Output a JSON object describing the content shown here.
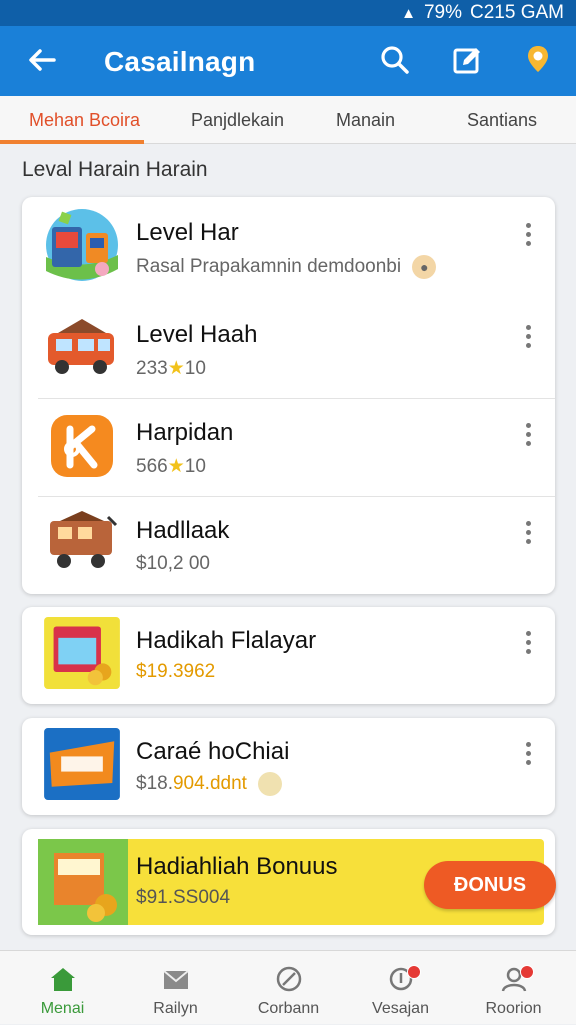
{
  "status_bar": {
    "battery": "79%",
    "time": "C215 GAM"
  },
  "app_bar": {
    "title": "Casailnagn"
  },
  "tabs": [
    {
      "label": "Mehan Bcoira",
      "active": true
    },
    {
      "label": "Panjdlekain"
    },
    {
      "label": "Manain"
    },
    {
      "label": "Santians"
    }
  ],
  "section_title": "Leval Harain Harain",
  "items": [
    {
      "name": "Level Har",
      "sub": "Rasal Prapakamnin demdoonbi"
    },
    {
      "name": "Level Haah",
      "sub": "233",
      "sub2": "10"
    },
    {
      "name": "Harpidan",
      "sub": "566",
      "sub2": "10"
    },
    {
      "name": "Hadllaak",
      "sub": "$10,2 00"
    },
    {
      "name": "Hadikah Flalayar",
      "sub": "$19.3962"
    },
    {
      "name": "Caraé hoChiai",
      "sub": "$18.",
      "sub_gold": "904.ddnt"
    },
    {
      "name": "Hadiahliah Bonuus",
      "sub": "$91.SS004",
      "button": "ĐONUS"
    }
  ],
  "bottom_nav": [
    {
      "label": "Menai",
      "icon": "home-icon",
      "active": true
    },
    {
      "label": "Railyn",
      "icon": "mail-icon"
    },
    {
      "label": "Corbann",
      "icon": "feather-icon"
    },
    {
      "label": "Vesajan",
      "icon": "trophy-icon",
      "badge": true
    },
    {
      "label": "Roorion",
      "icon": "profile-icon",
      "badge": true
    }
  ],
  "colors": {
    "app_bar": "#1a80d8",
    "status_bar": "#0f5fa8",
    "accent": "#f08030",
    "bonus_bg": "#f7e03a",
    "button": "#ee5a24"
  }
}
